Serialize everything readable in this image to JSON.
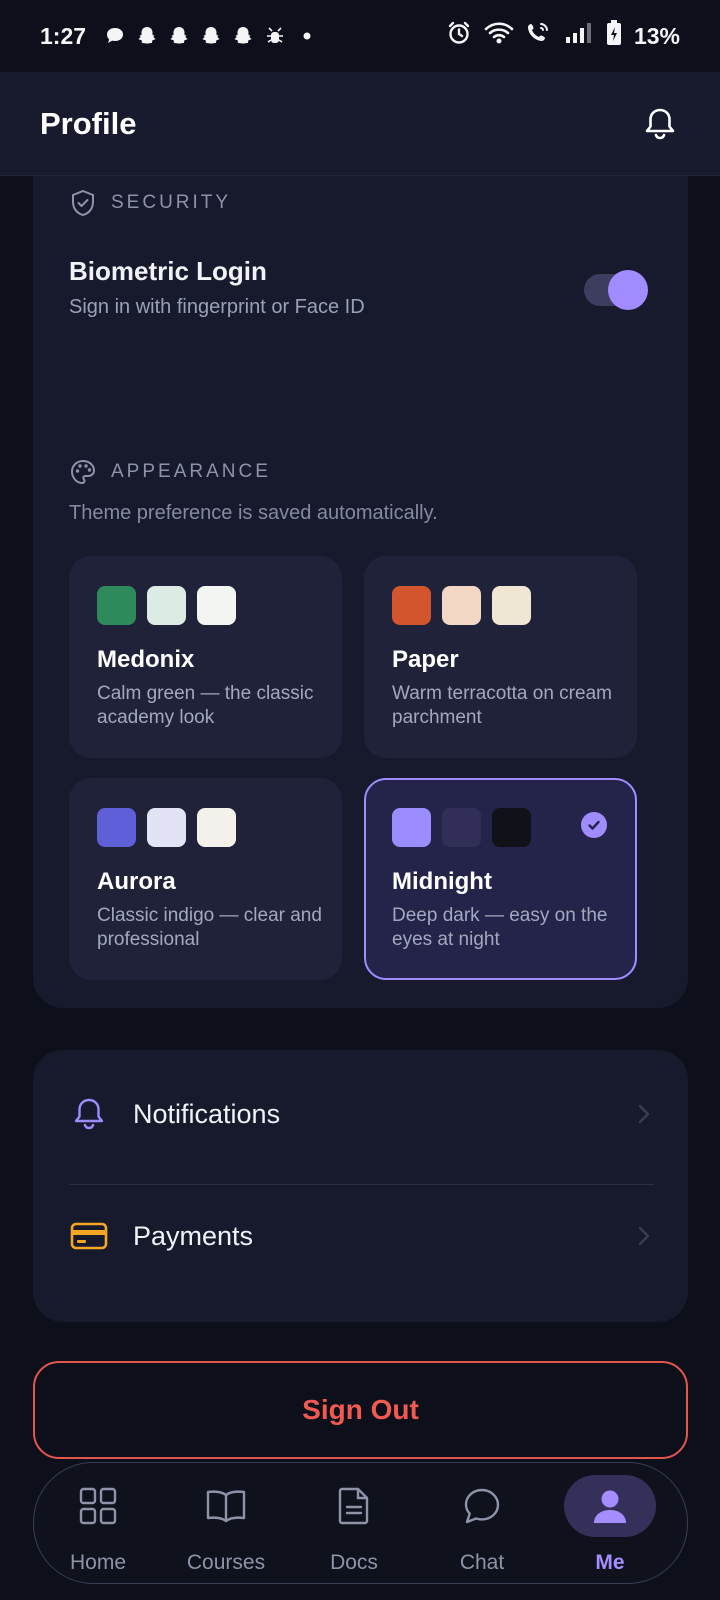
{
  "status_bar": {
    "time": "1:27",
    "battery_percent": "13%",
    "left_icons": [
      "chat-bubble-icon",
      "snapchat-icon",
      "snapchat-icon",
      "snapchat-icon",
      "snapchat-icon",
      "bug-icon",
      "dot-icon"
    ],
    "right_icons": [
      "alarm-icon",
      "wifi-icon",
      "wifi-call-icon",
      "signal-icon",
      "battery-charging-icon"
    ]
  },
  "header": {
    "title": "Profile",
    "bell_icon": "bell-icon"
  },
  "security": {
    "label": "SECURITY",
    "icon": "shield-check-icon",
    "biometric_title": "Biometric Login",
    "biometric_subtitle": "Sign in with fingerprint or Face ID",
    "biometric_enabled": true
  },
  "appearance": {
    "label": "APPEARANCE",
    "icon": "palette-icon",
    "hint": "Theme preference is saved automatically.",
    "themes": [
      {
        "name": "Medonix",
        "description": "Calm green — the classic academy look",
        "swatches": [
          "#2e8a5a",
          "#dcebe3",
          "#f3f5f3"
        ],
        "selected": false
      },
      {
        "name": "Paper",
        "description": "Warm terracotta on cream parchment",
        "swatches": [
          "#d2552d",
          "#f2d8c4",
          "#efe6d4"
        ],
        "selected": false
      },
      {
        "name": "Aurora",
        "description": "Classic indigo — clear and professional",
        "swatches": [
          "#5f5fd8",
          "#e2e3f5",
          "#f3f1ea"
        ],
        "selected": false
      },
      {
        "name": "Midnight",
        "description": "Deep dark — easy on the eyes at night",
        "swatches": [
          "#9b8cff",
          "#312f58",
          "#101119"
        ],
        "selected": true
      }
    ]
  },
  "links": [
    {
      "label": "Notifications",
      "icon": "bell-icon",
      "icon_color": "#9d8bff"
    },
    {
      "label": "Payments",
      "icon": "credit-card-icon",
      "icon_color": "#f5a623"
    }
  ],
  "sign_out_label": "Sign Out",
  "nav": {
    "items": [
      {
        "label": "Home",
        "icon": "grid-icon"
      },
      {
        "label": "Courses",
        "icon": "book-icon"
      },
      {
        "label": "Docs",
        "icon": "document-icon"
      },
      {
        "label": "Chat",
        "icon": "chat-icon"
      },
      {
        "label": "Me",
        "icon": "user-icon"
      }
    ],
    "active": "Me"
  },
  "colors": {
    "accent": "#a08cff",
    "danger": "#e3564e",
    "background": "#0d0f1a",
    "card": "#171a2d"
  }
}
